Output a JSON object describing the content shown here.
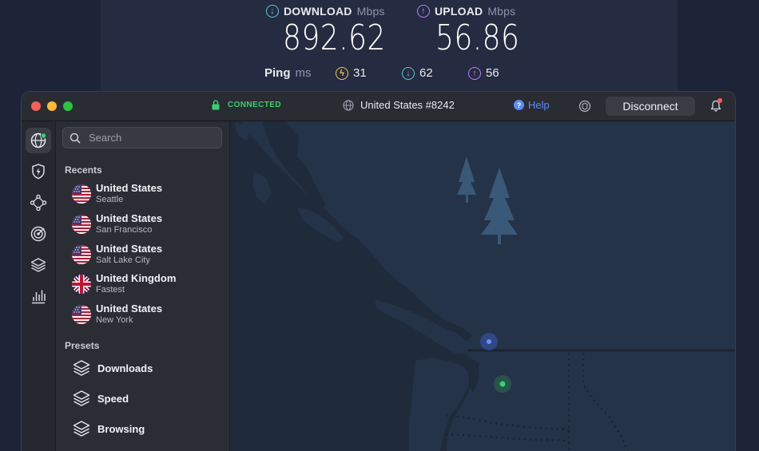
{
  "speed_test": {
    "download": {
      "label": "DOWNLOAD",
      "unit": "Mbps",
      "value": "892.62"
    },
    "upload": {
      "label": "UPLOAD",
      "unit": "Mbps",
      "value": "56.86"
    },
    "ping": {
      "label": "Ping",
      "unit": "ms",
      "idle": "31",
      "download": "62",
      "upload": "56"
    }
  },
  "titlebar": {
    "status": "CONNECTED",
    "server": "United States #8242",
    "help": "Help",
    "disconnect": "Disconnect"
  },
  "search": {
    "placeholder": "Search"
  },
  "sidebar": {
    "recents_title": "Recents",
    "recents": [
      {
        "country": "United States",
        "city": "Seattle",
        "flag": "us-flag-icon"
      },
      {
        "country": "United States",
        "city": "San Francisco",
        "flag": "us-flag-icon"
      },
      {
        "country": "United States",
        "city": "Salt Lake City",
        "flag": "us-flag-icon"
      },
      {
        "country": "United Kingdom",
        "city": "Fastest",
        "flag": "uk-flag-icon"
      },
      {
        "country": "United States",
        "city": "New York",
        "flag": "us-flag-icon"
      }
    ],
    "presets_title": "Presets",
    "presets": [
      {
        "label": "Downloads",
        "icon": "layers-icon"
      },
      {
        "label": "Speed",
        "icon": "layers-icon"
      },
      {
        "label": "Browsing",
        "icon": "layers-icon"
      }
    ]
  },
  "rail": [
    "globe-icon",
    "shield-bolt-icon",
    "meshnet-icon",
    "target-icon",
    "layers-icon",
    "stats-icon"
  ],
  "colors": {
    "connected": "#3ccf70",
    "download": "#4fd1d9",
    "upload": "#b983ff",
    "ping": "#f2c94c",
    "help": "#5b8cff",
    "map_water": "#1f2b3b",
    "map_land": "#243347"
  }
}
